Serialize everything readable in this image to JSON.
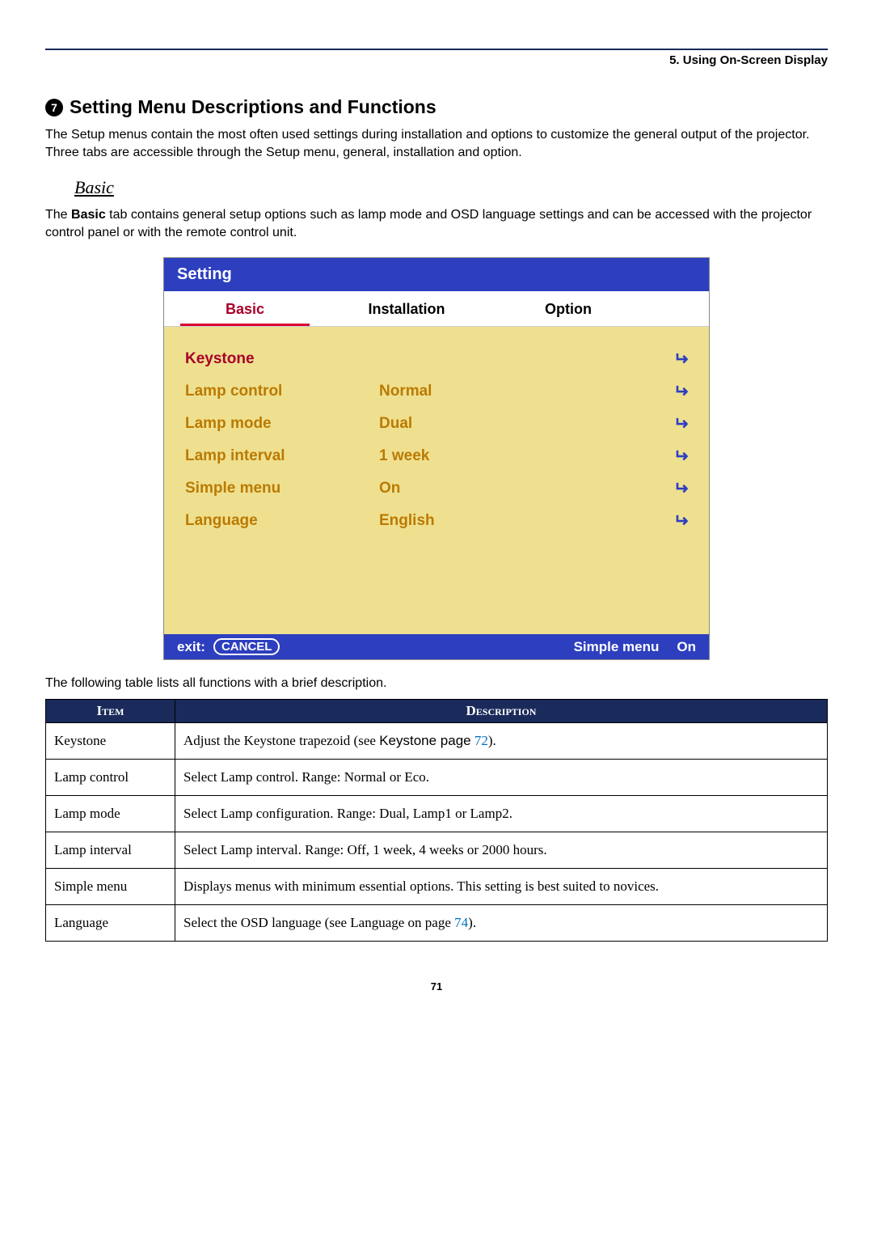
{
  "chapter": "5. Using On-Screen Display",
  "section_number": "7",
  "section_title": "Setting Menu Descriptions and Functions",
  "intro_para": "The Setup menus contain the most often used settings during installation and options to customize the general output of the projector. Three tabs are accessible through the Setup menu, general, installation and option.",
  "subheading": "Basic",
  "basic_para_prefix": "The ",
  "basic_para_bold": "Basic",
  "basic_para_rest": " tab contains general setup options such as lamp mode and OSD language settings and can be accessed with the projector control panel or with the remote control unit.",
  "osd": {
    "title": "Setting",
    "tabs": [
      "Basic",
      "Installation",
      "Option"
    ],
    "active_tab": 0,
    "rows": [
      {
        "label": "Keystone",
        "value": "",
        "selected": true,
        "enter": true
      },
      {
        "label": "Lamp control",
        "value": "Normal",
        "selected": false,
        "enter": true
      },
      {
        "label": "Lamp mode",
        "value": "Dual",
        "selected": false,
        "enter": true
      },
      {
        "label": "Lamp interval",
        "value": "1 week",
        "selected": false,
        "enter": true
      },
      {
        "label": "Simple menu",
        "value": "On",
        "selected": false,
        "enter": true
      },
      {
        "label": "Language",
        "value": "English",
        "selected": false,
        "enter": true
      }
    ],
    "footer": {
      "exit_label": "exit:",
      "exit_button": "CANCEL",
      "right_label": "Simple menu",
      "right_value": "On"
    }
  },
  "table_intro": "The following table lists all functions with a brief description.",
  "table": {
    "head_item": "Item",
    "head_desc": "Description",
    "rows": [
      {
        "item": "Keystone",
        "desc_pre": "Adjust the Keystone trapezoid (see ",
        "desc_sans": "Keystone page",
        "desc_ref": " 72",
        "desc_post": ")."
      },
      {
        "item": "Lamp control",
        "desc_pre": "Select Lamp control. Range: Normal or Eco.",
        "desc_sans": "",
        "desc_ref": "",
        "desc_post": ""
      },
      {
        "item": "Lamp mode",
        "desc_pre": "Select Lamp configuration. Range: Dual, Lamp1 or Lamp2.",
        "desc_sans": "",
        "desc_ref": "",
        "desc_post": ""
      },
      {
        "item": "Lamp interval",
        "desc_pre": "Select Lamp interval. Range: Off, 1 week, 4 weeks or 2000 hours.",
        "desc_sans": "",
        "desc_ref": "",
        "desc_post": ""
      },
      {
        "item": "Simple menu",
        "desc_pre": "Displays menus with minimum essential options. This setting is best suited to novices.",
        "desc_sans": "",
        "desc_ref": "",
        "desc_post": ""
      },
      {
        "item": "Language",
        "desc_pre": "Select the OSD language (see Language on page ",
        "desc_sans": "",
        "desc_ref": "74",
        "desc_post": ")."
      }
    ]
  },
  "page_number": "71"
}
